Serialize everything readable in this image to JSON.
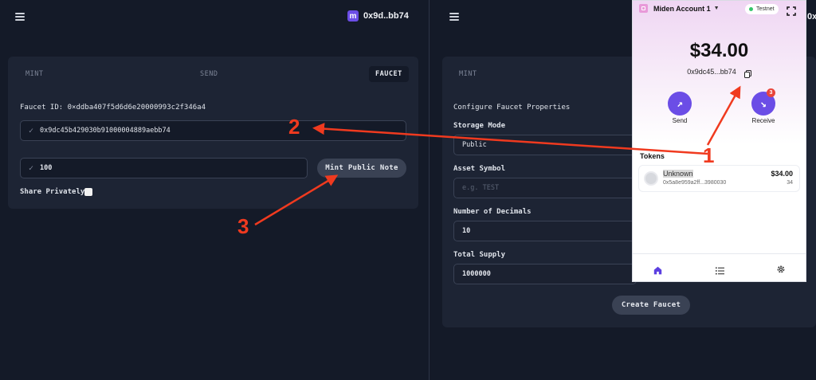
{
  "left_panel": {
    "account_short": "0x9d..bb74",
    "tabs": [
      "MINT",
      "SEND",
      "FAUCET"
    ],
    "faucet_id": "Faucet ID: 0×ddba407f5d6d6e20000993c2f346a4",
    "address_value": "0x9dc45b429030b91000004889aebb74",
    "amount_value": "100",
    "mint_button": "Mint Public Note",
    "share_privately": "Share Privately"
  },
  "right_panel": {
    "account_short_partial": "0x",
    "tab_mint": "MINT",
    "configure_title": "Configure Faucet Properties",
    "storage_mode_label": "Storage Mode",
    "storage_mode_value": "Public",
    "asset_symbol_label": "Asset Symbol",
    "asset_symbol_placeholder": "e.g. TEST",
    "decimals_label": "Number of Decimals",
    "decimals_value": "10",
    "supply_label": "Total Supply",
    "supply_value": "1000000",
    "create_button": "Create Faucet"
  },
  "wallet": {
    "account_name": "Miden Account 1",
    "network": "Testnet",
    "balance": "$34.00",
    "address": "0x9dc45...bb74",
    "send_label": "Send",
    "receive_label": "Receive",
    "receive_badge": "3",
    "tokens_title": "Tokens",
    "token": {
      "name": "Unknown",
      "address": "0x5a8e959a2ff...3980030",
      "value": "$34.00",
      "amount": "34"
    }
  },
  "annotations": {
    "step1": "1",
    "step2": "2",
    "step3": "3",
    "color": "#f03a1f"
  },
  "colors": {
    "background": "#141a28",
    "card": "#1d2434",
    "accent_purple": "#6b4de6",
    "network_dot": "#35c56b",
    "badge": "#e8453c"
  }
}
